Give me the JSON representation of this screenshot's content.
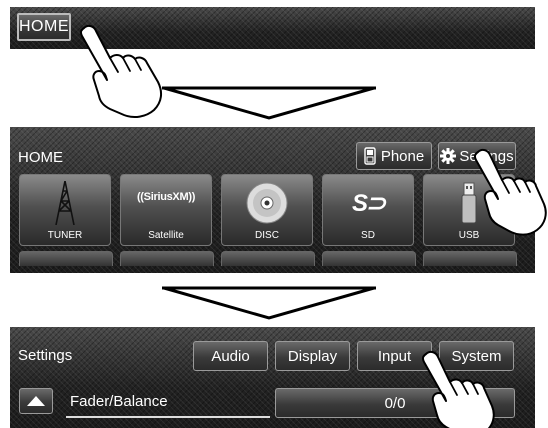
{
  "step1": {
    "home_button": "HOME"
  },
  "step2": {
    "header_title": "HOME",
    "phone_button": "Phone",
    "settings_button": "Settings",
    "sources": [
      {
        "label": "TUNER",
        "icon": "tower-icon"
      },
      {
        "label": "Satellite",
        "icon": "siriusxm-logo"
      },
      {
        "label": "DISC",
        "icon": "disc-icon"
      },
      {
        "label": "SD",
        "icon": "sd-card-icon"
      },
      {
        "label": "USB",
        "icon": "usb-icon"
      }
    ],
    "siriusxm_logo_text": "((SiriusXM))"
  },
  "step3": {
    "header_title": "Settings",
    "tabs": [
      "Audio",
      "Display",
      "Input",
      "System"
    ],
    "row_label": "Fader/Balance",
    "row_value": "0/0"
  }
}
